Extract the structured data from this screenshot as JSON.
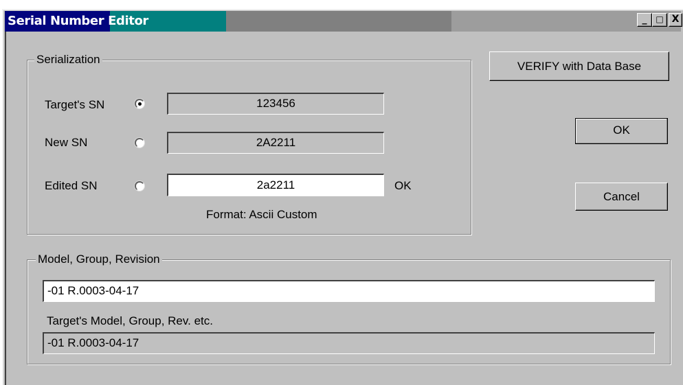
{
  "window": {
    "title_part1": "Serial Number",
    "title_part2": "Editor",
    "controls": {
      "minimize": "_",
      "maximize": "□",
      "close": "X"
    }
  },
  "serialization": {
    "group_label": "Serialization",
    "rows": [
      {
        "label": "Target's SN",
        "value": "123456",
        "selected": true,
        "editable": false
      },
      {
        "label": "New SN",
        "value": "2A2211",
        "selected": false,
        "editable": false
      },
      {
        "label": "Edited SN",
        "value": "2a2211",
        "selected": false,
        "editable": true,
        "status": "OK"
      }
    ],
    "format_text": "Format: Ascii Custom"
  },
  "buttons": {
    "verify": "VERIFY with Data Base",
    "ok": "OK",
    "cancel": "Cancel"
  },
  "model": {
    "group_label": "Model, Group, Revision",
    "edit_value": "-01 R.0003-04-17",
    "target_label": "Target's Model, Group, Rev. etc.",
    "target_value": "-01 R.0003-04-17"
  },
  "colors": {
    "titlebar_active": "#02047e",
    "titlebar_teal": "#02807f",
    "face": "#c0c0c0"
  }
}
